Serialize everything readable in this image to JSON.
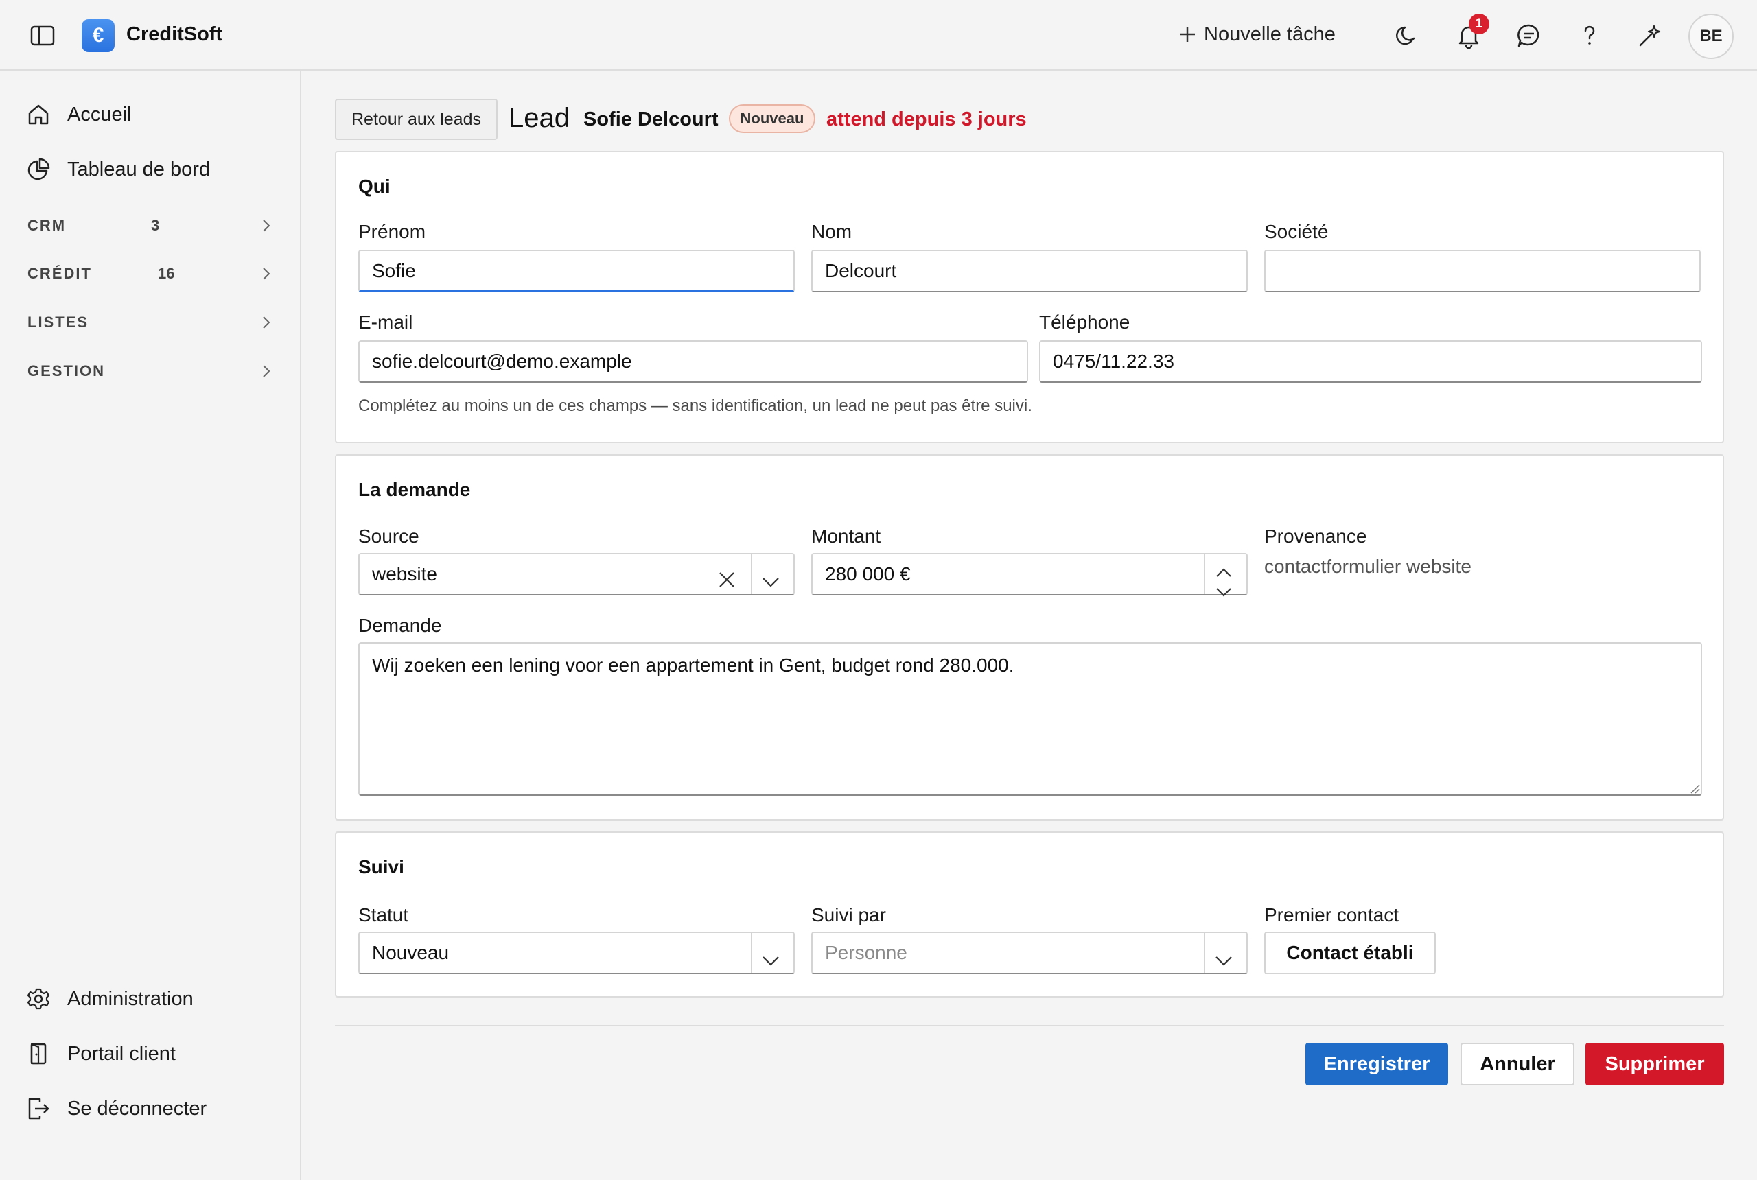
{
  "app": {
    "title": "CreditSoft",
    "logo_glyph": "€",
    "accent_color": "#2a72df"
  },
  "topbar": {
    "new_task_label": "Nouvelle tâche",
    "notification_count": "1",
    "avatar_initials": "BE",
    "icons": [
      "sidebar-toggle-icon",
      "plus-icon",
      "moon-icon",
      "bell-icon",
      "chat-icon",
      "help-icon",
      "sparkle-icon"
    ]
  },
  "sidebar": {
    "items": [
      {
        "label": "Accueil",
        "icon": "home-icon"
      },
      {
        "label": "Tableau de bord",
        "icon": "pie-chart-icon"
      }
    ],
    "sections": [
      {
        "label": "CRM",
        "count": "3"
      },
      {
        "label": "CRÉDIT",
        "count": "16"
      },
      {
        "label": "LISTES",
        "count": ""
      },
      {
        "label": "GESTION",
        "count": ""
      }
    ],
    "bottom_items": [
      {
        "label": "Administration",
        "icon": "gear-icon"
      },
      {
        "label": "Portail client",
        "icon": "door-icon"
      },
      {
        "label": "Se déconnecter",
        "icon": "logout-icon"
      }
    ]
  },
  "header": {
    "back_label": "Retour aux leads",
    "lead_label": "Lead",
    "lead_name": "Sofie Delcourt",
    "status_badge": "Nouveau",
    "waiting_text": "attend depuis 3 jours",
    "waiting_color": "#d0182a"
  },
  "qui": {
    "title": "Qui",
    "first_name_label": "Prénom",
    "first_name_value": "Sofie",
    "last_name_label": "Nom",
    "last_name_value": "Delcourt",
    "company_label": "Société",
    "company_value": "",
    "email_label": "E-mail",
    "email_value": "sofie.delcourt@demo.example",
    "phone_label": "Téléphone",
    "phone_value": "0475/11.22.33",
    "hint": "Complétez au moins un de ces champs — sans identification, un lead ne peut pas être suivi."
  },
  "demande": {
    "title": "La demande",
    "source_label": "Source",
    "source_value": "website",
    "amount_label": "Montant",
    "amount_value": "280 000 €",
    "origin_label": "Provenance",
    "origin_value": "contactformulier website",
    "request_label": "Demande",
    "request_value": "Wij zoeken een lening voor een appartement in Gent, budget rond 280.000."
  },
  "suivi": {
    "title": "Suivi",
    "status_label": "Statut",
    "status_value": "Nouveau",
    "followed_by_label": "Suivi par",
    "followed_by_placeholder": "Personne",
    "first_contact_label": "Premier contact",
    "first_contact_button": "Contact établi"
  },
  "actions": {
    "save": "Enregistrer",
    "cancel": "Annuler",
    "delete": "Supprimer",
    "save_color": "#1e6cc8",
    "delete_color": "#d3182a"
  }
}
